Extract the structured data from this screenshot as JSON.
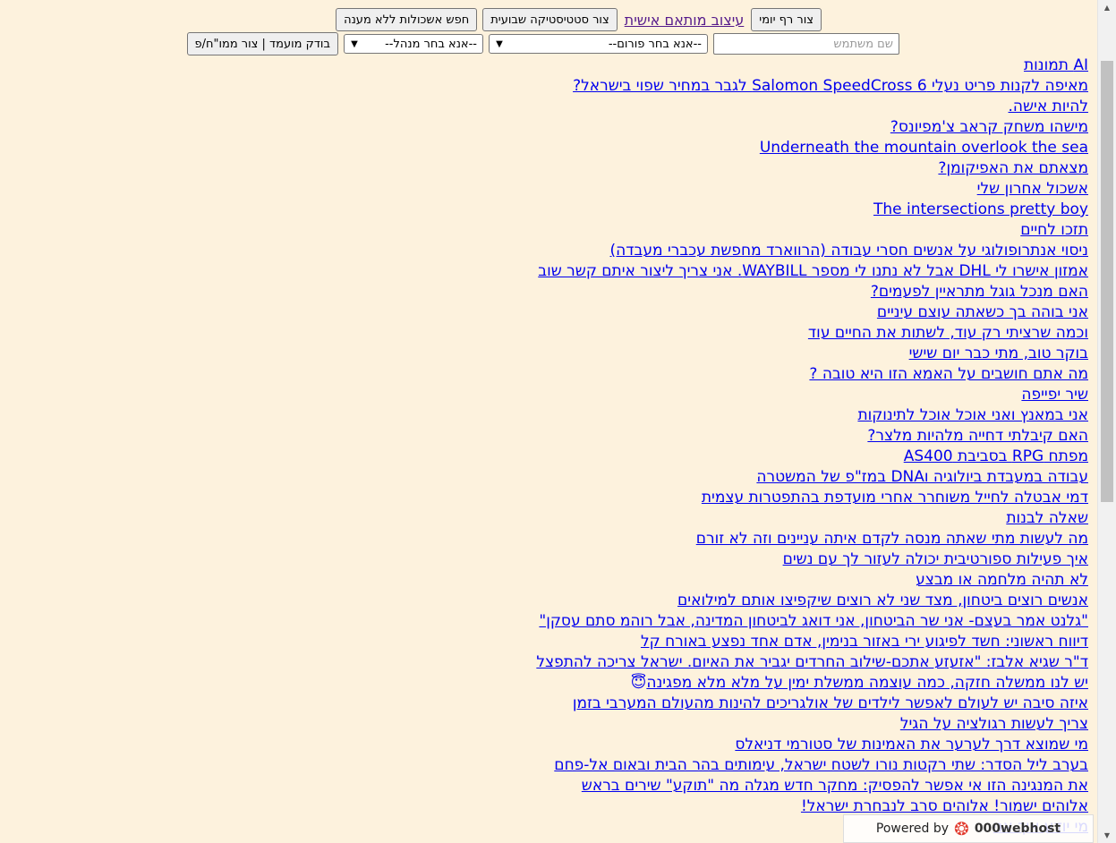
{
  "toolbar": {
    "daily_sheet": "צור רף יומי",
    "personal_design": "עיצוב מותאם אישית",
    "weekly_stats": "צור סטטיסטיקה שבועית",
    "unanswered": "חפש אשכולות ללא מענה",
    "username_placeholder": "שם משתמש",
    "forum_select": "--אנא בחר פורום--",
    "manager_select": "--אנא בחר מנהל--",
    "candidate_check": "בודק מועמד | צור ממו\"ח/פ"
  },
  "threads": [
    "AI תמונות",
    "מאיפה לקנות פריט נעלי Salomon SpeedCross 6 לגבר במחיר שפוי בישראל?",
    "להיות אישה.",
    "מישהו משחק קראב צ'מפיונס?",
    "Underneath the mountain overlook the sea",
    "מצאתם את האפיקומן?",
    "אשכול אחרון שלי",
    "The intersections pretty boy",
    "תזכו לחיים",
    "ניסוי אנתרופולוגי על אנשים חסרי עבודה (הרווארד מחפשת עכברי מעבדה)",
    "אמזון אישרו לי DHL אבל לא נתנו לי מספר WAYBILL. אני צריך ליצור איתם קשר שוב",
    "האם מנכל גוגל מתראיין לפעמים?",
    "אני בוהה בך כשאתה עוצם עיניים",
    "וכמה שרציתי רק עוד, לשתות את החיים עוד",
    "בוקר טוב, מתי כבר יום שישי",
    "מה אתם חושבים על האמא הזו היא טובה ?",
    "שיר יפייפה",
    "אני במאנץ ואני אוכל אוכל לתינוקות",
    "האם קיבלתי דחייה מלהיות מלצר?",
    "מפתח RPG בסביבת AS400",
    "עבודה במעבדת ביולוגיה וDNA במז\"פ של המשטרה",
    "דמי אבטלה לחייל משוחרר אחרי מועדפת בהתפטרות עצמית",
    "שאלה לבנות",
    "מה לעשות מתי שאתה מנסה לקדם איתה עניינים וזה לא זורם",
    "איך פעילות ספורטיבית יכולה לעזור לך עם נשים",
    "לא תהיה מלחמה או מבצע",
    "אנשים רוצים ביטחון, מצד שני לא רוצים שיקפיצו אותם למילואים",
    "\"גלנט אמר בעצם- אני שר הביטחון, אני דואג לביטחון המדינה, אבל רוהמ סתם עסקן\"",
    "דיווח ראשוני: חשד לפיגוע ירי באזור בנימין, אדם אחד נפצע באורח קל",
    "ד\"ר שגיא אלבז: \"אזעזע אתכם-שילוב החרדים יגביר את האיום. ישראל צריכה להתפצל",
    "יש לנו ממשלה חזקה, כמה עוצמה ממשלת ימין על מלא מלא מפגינה",
    "איזה סיבה יש לעולם לאפשר לילדים של אולגריכים להינות מהעולם המערבי בזמן",
    "צריך לעשות רגולציה על הגיל",
    "מי שמוצא דרך לערער את האמינות של סטורמי דניאלס",
    "בערב ליל הסדר: שתי רקטות נורו לשטח ישראל, עימותים בהר הבית ובאום אל-פחם",
    "את המנגינה הזו אי אפשר להפסיק: מחקר חדש מגלה מה \"תוקע\" שירים בראש",
    "אלוהים ישמור! אלוהים סרב לנבחרת ישראל!",
    "מי יודע איך אני"
  ],
  "emoji_row_index": 30,
  "emoji": "😇",
  "badge": {
    "powered_by": "Powered by",
    "brand": "000webhost"
  },
  "icons": {
    "select_chevron": "chevron-down-icon",
    "scroll_up": "scroll-up-arrow-icon",
    "scroll_down": "scroll-down-arrow-icon",
    "badge_logo": "webhost-logo-icon"
  }
}
